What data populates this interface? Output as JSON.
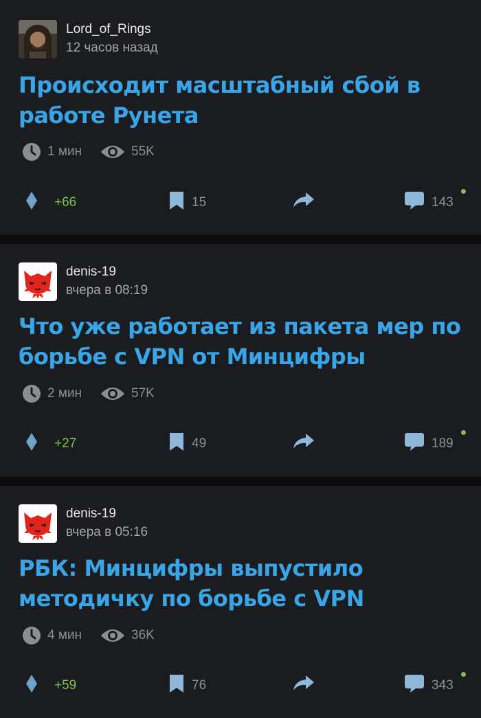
{
  "colors": {
    "background": "#0b0b0b",
    "card": "#1b1c1f",
    "title": "#3aa5e6",
    "positive": "#7cc44a",
    "muted": "#8b8e93"
  },
  "posts": [
    {
      "author": "Lord_of_Rings",
      "time": "12 часов назад",
      "title": "Происходит масштабный сбой в работе Рунета",
      "read_time": "1 мин",
      "views": "55K",
      "rating": "+66",
      "saves": "15",
      "comments": "143"
    },
    {
      "author": "denis-19",
      "time": "вчера в 08:19",
      "title": "Что уже работает из пакета мер по борьбе с VPN от Минцифры",
      "read_time": "2 мин",
      "views": "57K",
      "rating": "+27",
      "saves": "49",
      "comments": "189"
    },
    {
      "author": "denis-19",
      "time": "вчера в 05:16",
      "title": "РБК: Минцифры выпустило методичку по борьбе с VPN",
      "read_time": "4 мин",
      "views": "36K",
      "rating": "+59",
      "saves": "76",
      "comments": "343"
    }
  ]
}
